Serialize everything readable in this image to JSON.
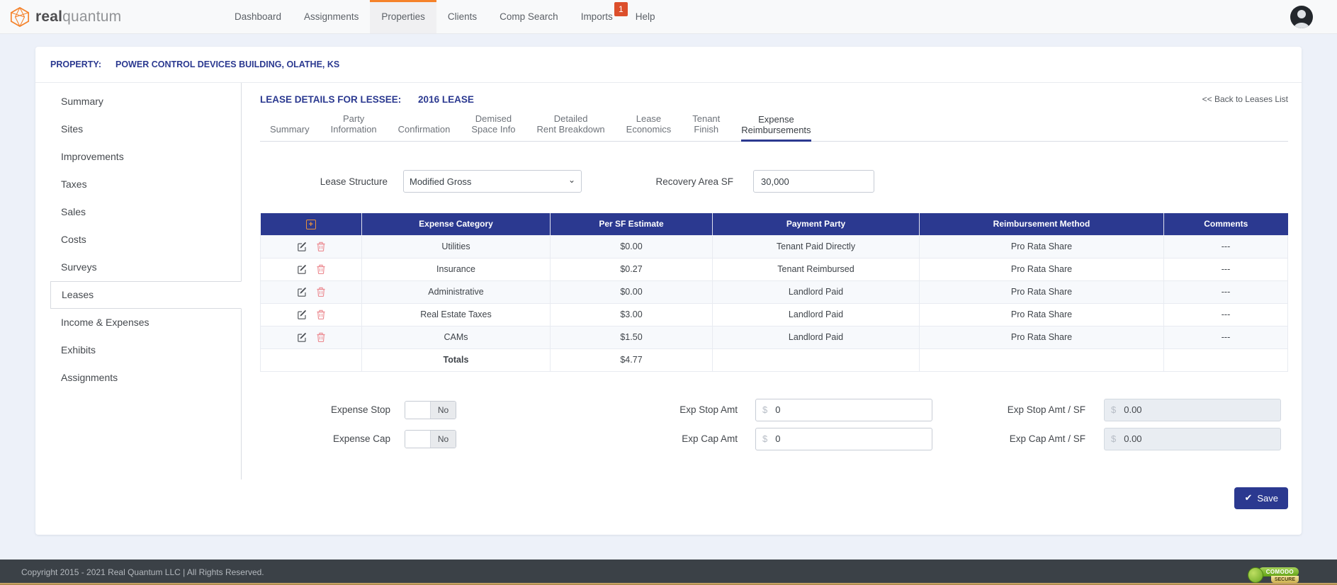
{
  "nav": {
    "brand": {
      "bold": "real",
      "light": "quantum"
    },
    "items": [
      {
        "label": "Dashboard"
      },
      {
        "label": "Assignments"
      },
      {
        "label": "Properties",
        "active": true
      },
      {
        "label": "Clients"
      },
      {
        "label": "Comp Search"
      },
      {
        "label": "Imports",
        "badge": "1"
      },
      {
        "label": "Help"
      }
    ]
  },
  "breadcrumb": {
    "label": "PROPERTY:",
    "value": "POWER CONTROL DEVICES BUILDING, OLATHE, KS"
  },
  "sidebar": {
    "items": [
      {
        "label": "Summary"
      },
      {
        "label": "Sites"
      },
      {
        "label": "Improvements"
      },
      {
        "label": "Taxes"
      },
      {
        "label": "Sales"
      },
      {
        "label": "Costs"
      },
      {
        "label": "Surveys"
      },
      {
        "label": "Leases",
        "active": true
      },
      {
        "label": "Income & Expenses"
      },
      {
        "label": "Exhibits"
      },
      {
        "label": "Assignments"
      }
    ]
  },
  "lease": {
    "title_label": "LEASE DETAILS FOR LESSEE:",
    "title_value": "2016 LEASE",
    "back_link": "<< Back to Leases List",
    "tabs": [
      {
        "lines": [
          "Summary"
        ]
      },
      {
        "lines": [
          "Party",
          "Information"
        ]
      },
      {
        "lines": [
          "Confirmation"
        ]
      },
      {
        "lines": [
          "Demised",
          "Space Info"
        ]
      },
      {
        "lines": [
          "Detailed",
          "Rent Breakdown"
        ]
      },
      {
        "lines": [
          "Lease",
          "Economics"
        ]
      },
      {
        "lines": [
          "Tenant",
          "Finish"
        ]
      },
      {
        "lines": [
          "Expense",
          "Reimbursements"
        ],
        "active": true
      }
    ]
  },
  "form": {
    "lease_structure": {
      "label": "Lease Structure",
      "value": "Modified Gross"
    },
    "recovery_area": {
      "label": "Recovery Area SF",
      "value": "30,000"
    }
  },
  "table": {
    "columns": [
      "Expense Category",
      "Per SF Estimate",
      "Payment Party",
      "Reimbursement Method",
      "Comments"
    ],
    "rows": [
      {
        "category": "Utilities",
        "per_sf": "$0.00",
        "payment_party": "Tenant Paid Directly",
        "method": "Pro Rata Share",
        "comments": "---"
      },
      {
        "category": "Insurance",
        "per_sf": "$0.27",
        "payment_party": "Tenant Reimbursed",
        "method": "Pro Rata Share",
        "comments": "---"
      },
      {
        "category": "Administrative",
        "per_sf": "$0.00",
        "payment_party": "Landlord Paid",
        "method": "Pro Rata Share",
        "comments": "---"
      },
      {
        "category": "Real Estate Taxes",
        "per_sf": "$3.00",
        "payment_party": "Landlord Paid",
        "method": "Pro Rata Share",
        "comments": "---"
      },
      {
        "category": "CAMs",
        "per_sf": "$1.50",
        "payment_party": "Landlord Paid",
        "method": "Pro Rata Share",
        "comments": "---"
      }
    ],
    "totals": {
      "label": "Totals",
      "per_sf": "$4.77"
    }
  },
  "expense": {
    "stop": {
      "label": "Expense Stop",
      "toggle": "No",
      "amt_label": "Exp Stop Amt",
      "currency": "$",
      "amt_value": "0",
      "sf_label": "Exp Stop Amt / SF",
      "sf_value": "0.00"
    },
    "cap": {
      "label": "Expense Cap",
      "toggle": "No",
      "amt_label": "Exp Cap Amt",
      "currency": "$",
      "amt_value": "0",
      "sf_label": "Exp Cap Amt / SF",
      "sf_value": "0.00"
    }
  },
  "save": {
    "label": "Save"
  },
  "footer": {
    "copyright": "Copyright 2015 - 2021 Real Quantum LLC | All Rights Reserved.",
    "badge_top": "COMODO",
    "badge_bottom": "SECURE"
  },
  "colors": {
    "brand_navy": "#2b3990",
    "brand_orange": "#f5822a",
    "badge_red": "#dc4f2b"
  }
}
